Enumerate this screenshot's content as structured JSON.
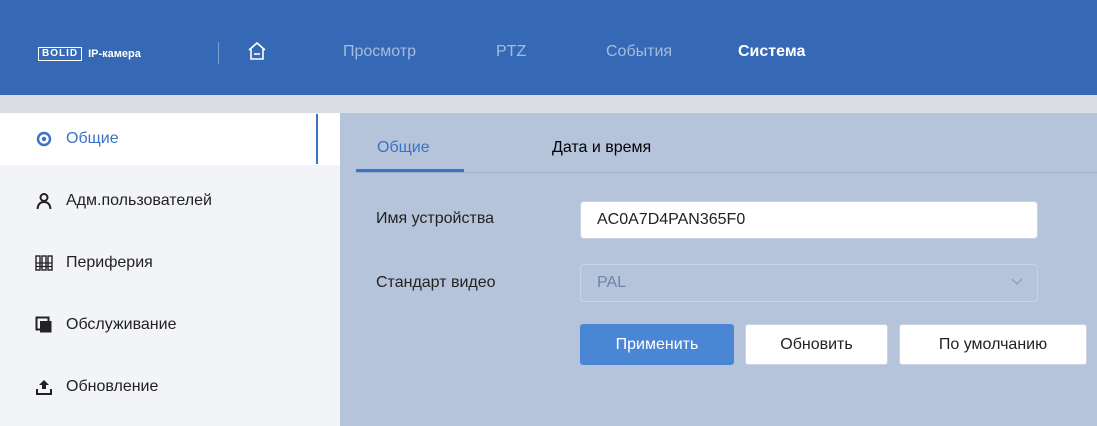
{
  "header": {
    "logo_brand": "BOLID",
    "logo_sub": "IP-камера",
    "nav": [
      "Просмотр",
      "PTZ",
      "События",
      "Система"
    ],
    "active_nav": "Система"
  },
  "sidebar": {
    "items": [
      {
        "label": "Общие",
        "icon": "gear-icon"
      },
      {
        "label": "Адм.пользователей",
        "icon": "user-icon"
      },
      {
        "label": "Периферия",
        "icon": "peripheral-icon"
      },
      {
        "label": "Обслуживание",
        "icon": "maintenance-icon"
      },
      {
        "label": "Обновление",
        "icon": "upload-icon"
      }
    ],
    "active": "Общие"
  },
  "main": {
    "tabs": [
      "Общие",
      "Дата и время"
    ],
    "active_tab": "Общие",
    "device_name_label": "Имя устройства",
    "device_name_value": "AC0A7D4PAN365F0",
    "video_standard_label": "Стандарт видео",
    "video_standard_value": "PAL",
    "buttons": {
      "apply": "Применить",
      "refresh": "Обновить",
      "default": "По умолчанию"
    }
  },
  "colors": {
    "header_bg": "#3569b5",
    "accent": "#3a72c4",
    "content_bg": "#b6c4db"
  }
}
